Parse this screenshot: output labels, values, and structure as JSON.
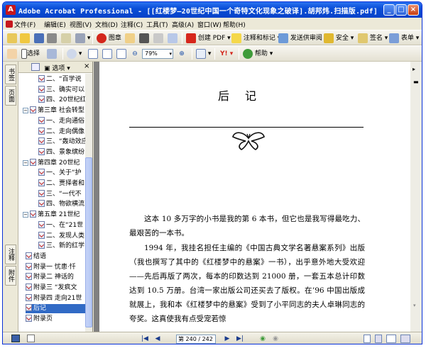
{
  "window": {
    "title": "Adobe Acrobat Professional - [[红楼梦—20世纪中国一个奇特文化现象之破译].胡邦炜.扫描版.pdf]",
    "icon": "acrobat-icon"
  },
  "menu": [
    "文件(F)",
    "编辑(E)",
    "视图(V)",
    "文档(D)",
    "注释(C)",
    "工具(T)",
    "高级(A)",
    "窗口(W)",
    "帮助(H)"
  ],
  "toolbar1": {
    "image_label": "图章",
    "create_pdf": "创建 PDF",
    "review_comment": "注释和标记",
    "send_review": "发送供审阅",
    "security": "安全",
    "sign": "签名",
    "forms": "表单"
  },
  "toolbar2": {
    "select_label": "选择",
    "snapshot_label": "快照",
    "zoom_value": "79%",
    "help_label": "帮助"
  },
  "sidebar_tabs": [
    "书签",
    "页面",
    "注释",
    "附件"
  ],
  "nav_panel": {
    "options_label": "选项"
  },
  "bookmarks": [
    {
      "level": 2,
      "text": "二、“百学说"
    },
    {
      "level": 2,
      "text": "三、确实可以"
    },
    {
      "level": 2,
      "text": "四、20世纪红"
    },
    {
      "level": 1,
      "text": "第三章 社会转型"
    },
    {
      "level": 2,
      "text": "一、走向通俗"
    },
    {
      "level": 2,
      "text": "二、走向偶像"
    },
    {
      "level": 2,
      "text": "三、“轰动效应"
    },
    {
      "level": 2,
      "text": "四、景象缤纷"
    },
    {
      "level": 1,
      "text": "第四章 20世纪"
    },
    {
      "level": 2,
      "text": "一、关于“护"
    },
    {
      "level": 2,
      "text": "二、贾择者和"
    },
    {
      "level": 2,
      "text": "三、“一代不"
    },
    {
      "level": 2,
      "text": "四、物欲横流"
    },
    {
      "level": 1,
      "text": "第五章 21世纪"
    },
    {
      "level": 2,
      "text": "一、在“21世"
    },
    {
      "level": 2,
      "text": "二、发现人类"
    },
    {
      "level": 2,
      "text": "三、新的红学"
    },
    {
      "level": 0,
      "text": "结语"
    },
    {
      "level": 0,
      "text": "附录一 忧患·忏"
    },
    {
      "level": 0,
      "text": "附录二 神话的"
    },
    {
      "level": 0,
      "text": "附录三 “发疯文"
    },
    {
      "level": 0,
      "text": "附录四 走向21世"
    },
    {
      "level": 0,
      "text": "后记",
      "selected": true
    },
    {
      "level": 0,
      "text": "附录页"
    }
  ],
  "document": {
    "heading": "后记",
    "paragraphs": [
      "这本 10 多万字的小书是我的第 6 本书，但它也是我写得最吃力、最艰苦的一本书。",
      "1994 年，我挂名担任主编的《中国古典文学名著悬案系列》出版（我也撰写了其中的《红楼梦中的悬案》一书），出乎意外地大受欢迎——先后再版了两次，每本的印数达到 21000 册，一套五本总计印数达到 10.5 万册。台湾一家出版公司还买去了版权。在’96 中国出版成就展上，我和本《红楼梦中的悬案》受到了小平同志的夫人卓琳同志的夸奖。这真使我有点受宠若惊"
    ]
  },
  "status": {
    "page_indicator": "第 240 / 242 页"
  },
  "colors": {
    "titlebar": "#0a4fd8",
    "selection": "#316ac5",
    "chrome": "#ece9d8"
  }
}
